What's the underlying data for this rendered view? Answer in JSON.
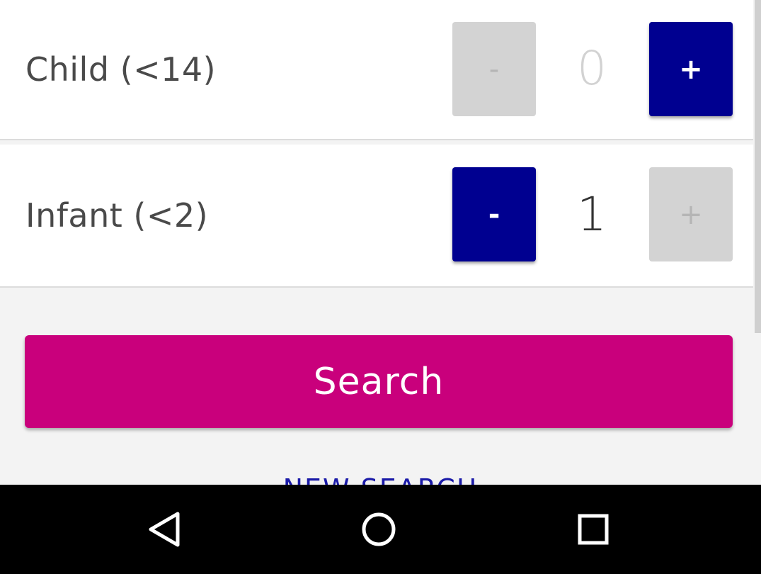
{
  "passengers": {
    "child": {
      "label": "Child (<14)",
      "minus_label": "-",
      "count": "0",
      "plus_label": "+"
    },
    "infant": {
      "label": "Infant (<2)",
      "minus_label": "-",
      "count": "1",
      "plus_label": "+"
    }
  },
  "search": {
    "button_label": "Search",
    "new_search_label": "NEW SEARCH"
  },
  "system_nav": {
    "back_icon": "back-triangle-icon",
    "home_icon": "home-circle-icon",
    "recents_icon": "recents-square-icon"
  },
  "colors": {
    "accent_blue": "#000090",
    "search_magenta": "#c9007c",
    "disabled_grey": "#d3d3d3"
  }
}
